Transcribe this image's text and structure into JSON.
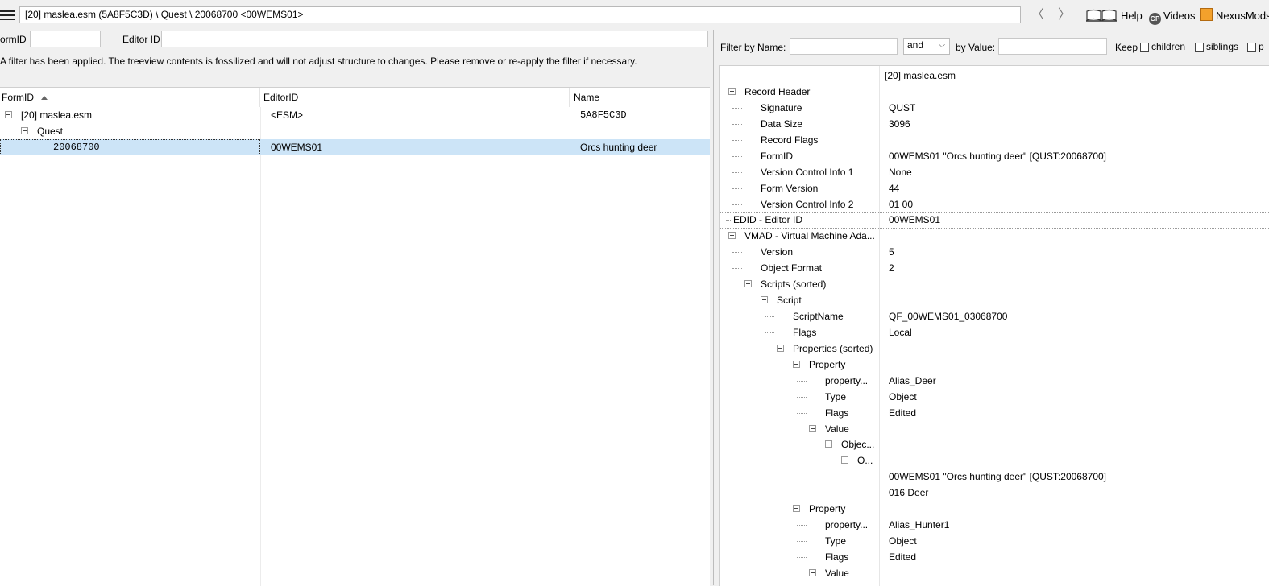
{
  "topbar": {
    "path": "[20] maslea.esm (5A8F5C3D) \\ Quest \\ 20068700 <00WEMS01>",
    "back": "〈",
    "forward": "〉",
    "help": "Help",
    "videos": "Videos",
    "videos_icon_text": "GP",
    "nexus": "NexusMods"
  },
  "filter": {
    "formid_label": "ormID",
    "formid_value": "",
    "editorid_label": "Editor ID",
    "editorid_value": "",
    "notice": "A filter has been applied. The treeview contents is fossilized and will not adjust structure to changes.  Please remove or re-apply the filter if necessary."
  },
  "left_grid": {
    "headers": {
      "formid": "FormID",
      "editorid": "EditorID",
      "name": "Name"
    },
    "rows": [
      {
        "formid": "[20] maslea.esm",
        "editorid": "<ESM>",
        "name": "5A8F5C3D"
      },
      {
        "formid": "Quest",
        "editorid": "",
        "name": ""
      },
      {
        "formid": "20068700",
        "editorid": "00WEMS01",
        "name": "Orcs hunting deer"
      }
    ]
  },
  "right_filter": {
    "by_name_label": "Filter by Name:",
    "name_value": "",
    "op": "and",
    "by_value_label": "by Value:",
    "value_value": "",
    "keep_label": "Keep",
    "children_label": "children",
    "siblings_label": "siblings",
    "parents_label": "p"
  },
  "record": {
    "file_header": "[20] maslea.esm",
    "rows": [
      {
        "label": "Record Header",
        "value": ""
      },
      {
        "label": "Signature",
        "value": "QUST"
      },
      {
        "label": "Data Size",
        "value": "3096"
      },
      {
        "label": "Record Flags",
        "value": ""
      },
      {
        "label": "FormID",
        "value": "00WEMS01 \"Orcs hunting deer\" [QUST:20068700]"
      },
      {
        "label": "Version Control Info 1",
        "value": "None"
      },
      {
        "label": "Form Version",
        "value": "44"
      },
      {
        "label": "Version Control Info 2",
        "value": "01 00"
      },
      {
        "label": "EDID - Editor ID",
        "value": "00WEMS01"
      },
      {
        "label": "VMAD - Virtual Machine Ada...",
        "value": ""
      },
      {
        "label": "Version",
        "value": "5"
      },
      {
        "label": "Object Format",
        "value": "2"
      },
      {
        "label": "Scripts (sorted)",
        "value": ""
      },
      {
        "label": "Script",
        "value": ""
      },
      {
        "label": "ScriptName",
        "value": "QF_00WEMS01_03068700"
      },
      {
        "label": "Flags",
        "value": "Local"
      },
      {
        "label": "Properties (sorted)",
        "value": ""
      },
      {
        "label": "Property",
        "value": ""
      },
      {
        "label": "property...",
        "value": "Alias_Deer"
      },
      {
        "label": "Type",
        "value": "Object"
      },
      {
        "label": "Flags",
        "value": "Edited"
      },
      {
        "label": "Value",
        "value": ""
      },
      {
        "label": "Objec...",
        "value": ""
      },
      {
        "label": "O...",
        "value": ""
      },
      {
        "label": "",
        "value": "00WEMS01 \"Orcs hunting deer\" [QUST:20068700]"
      },
      {
        "label": "",
        "value": "016 Deer"
      },
      {
        "label": "Property",
        "value": ""
      },
      {
        "label": "property...",
        "value": "Alias_Hunter1"
      },
      {
        "label": "Type",
        "value": "Object"
      },
      {
        "label": "Flags",
        "value": "Edited"
      },
      {
        "label": "Value",
        "value": ""
      }
    ]
  },
  "colors": {
    "selection": "#cce4f7",
    "grid_bg": "#ffffff",
    "window_bg": "#f0f0f0"
  }
}
